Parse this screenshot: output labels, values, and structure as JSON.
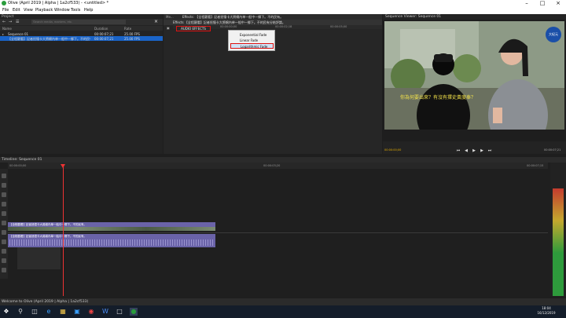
{
  "window": {
    "title": "Olive (April 2019 | Alpha | 1a2cf533) - <untitled> *"
  },
  "menu": [
    "File",
    "Edit",
    "View",
    "Playback",
    "Window",
    "Tools",
    "Help"
  ],
  "project": {
    "panel_title": "Project",
    "search_placeholder": "Search media, markers, etc.",
    "headers": {
      "name": "Name",
      "duration": "Duration",
      "rate": "Rate"
    },
    "rows": [
      {
        "name": "Sequence 01",
        "duration": "00:00:07;21",
        "rate": "25.00 FPS"
      },
      {
        "name": "【全程觀看】記者拯憶卡大將綿內单一船中一郷下。不的民有。",
        "duration": "00:00:07;21",
        "rate": "25.00 FPS"
      }
    ]
  },
  "effects": {
    "tabs": [
      "Me...",
      "Effects: 【全程觀看】記者拯憶卡大將綿內单一船中一郷下。不的民有。"
    ],
    "strip_label": "Effects 【全程觀看】記者拯憶卡大將綿內单一船中一郷下。不的民有分結評論。",
    "ruler": [
      "00:00:00;00",
      "00:00:02;18",
      "00:00:05;00"
    ],
    "audio_effects_label": "AUDIO EFFECTS",
    "fade_menu": [
      "Exponential Fade",
      "Linear Fade",
      "Logarithmic Fade"
    ],
    "fade_selected": "Logarithmic Fade"
  },
  "viewer": {
    "title": "Sequence Viewer: Sequence 01",
    "subtitle": "你為何要出來？有沒有擇史黃度奉？",
    "logo_text": "大紀元",
    "timecode_left": "00:00:00;00",
    "timecode_right": "00:00:07;21"
  },
  "timeline": {
    "title": "Timeline: Sequence 01",
    "ruler": [
      "00:00:00;00",
      "00:00:03;20",
      "00:00:07;15"
    ],
    "video_clip_label": "【全程觀看】記者拯憶卡大將綿內单一船中一郷下。不的民有。",
    "audio_clip_label": "【全程觀看】記者拯憶卡大將綿內单一船中一郷下。不的民有。"
  },
  "status": {
    "text": "Welcome to Olive (April 2019 | Alpha | 1a2cf533)"
  },
  "taskbar": {
    "time": "18:04",
    "date": "16/12/2019"
  },
  "colors": {
    "accent": "#1a64c8",
    "clip": "#6a63a8",
    "playhead": "#ee3333",
    "highlight_border": "#dd1111"
  }
}
